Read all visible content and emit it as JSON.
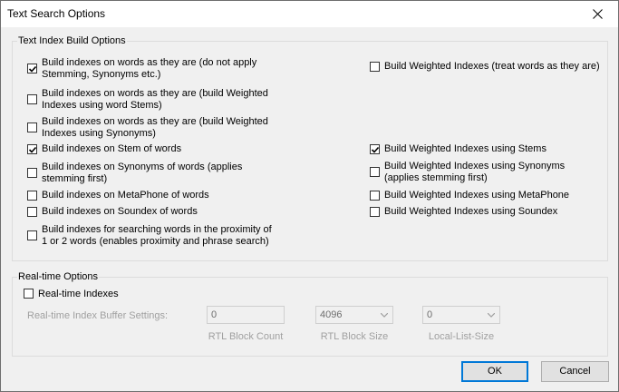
{
  "window": {
    "title": "Text Search Options"
  },
  "index_group": {
    "legend": "Text Index Build Options",
    "left": [
      {
        "lines": [
          "Build indexes on words as they are (do not apply",
          "Stemming, Synonyms etc.)"
        ],
        "checked": true
      },
      {
        "lines": [
          "Build indexes on words as they are (build Weighted",
          "Indexes using word Stems)"
        ],
        "checked": false
      },
      {
        "lines": [
          "Build indexes on words as they are (build Weighted",
          "Indexes using Synonyms)"
        ],
        "checked": false
      },
      {
        "lines": [
          "Build indexes on Stem of words"
        ],
        "checked": true
      },
      {
        "lines": [
          "Build indexes on Synonyms of words (applies",
          "stemming first)"
        ],
        "checked": false
      },
      {
        "lines": [
          "Build indexes on MetaPhone of words"
        ],
        "checked": false
      },
      {
        "lines": [
          "Build indexes on Soundex of words"
        ],
        "checked": false
      },
      {
        "lines": [
          "Build indexes for searching words in the proximity of",
          "1 or 2 words (enables proximity and phrase search)"
        ],
        "checked": false
      }
    ],
    "right": [
      {
        "lines": [
          "Build Weighted Indexes (treat words as they are)"
        ],
        "checked": false
      },
      {
        "lines": [
          "Build Weighted Indexes using Stems"
        ],
        "checked": true
      },
      {
        "lines": [
          "Build Weighted Indexes using Synonyms",
          "(applies stemming first)"
        ],
        "checked": false
      },
      {
        "lines": [
          "Build Weighted Indexes using MetaPhone"
        ],
        "checked": false
      },
      {
        "lines": [
          "Build Weighted Indexes using Soundex"
        ],
        "checked": false
      }
    ]
  },
  "realtime_group": {
    "legend": "Real-time Options",
    "realtime_checkbox": {
      "label": "Real-time Indexes",
      "checked": false
    },
    "buffer_label": "Real-time Index Buffer Settings:",
    "block_count": {
      "value": "0",
      "caption": "RTL Block Count"
    },
    "block_size": {
      "value": "4096",
      "caption": "RTL Block Size"
    },
    "local_list_size": {
      "value": "0",
      "caption": "Local-List-Size"
    }
  },
  "buttons": {
    "ok": "OK",
    "cancel": "Cancel"
  }
}
